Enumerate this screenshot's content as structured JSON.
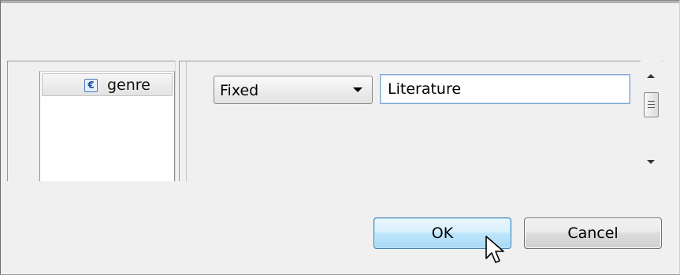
{
  "tree": {
    "items": [
      {
        "icon": "enum-icon",
        "icon_glyph": "€",
        "label": "genre"
      }
    ]
  },
  "editor": {
    "mode_selected": "Fixed",
    "value": "Literature"
  },
  "buttons": {
    "ok_label": "OK",
    "cancel_label": "Cancel"
  },
  "colors": {
    "dialog_bg": "#f0f0f0",
    "ok_border": "#3c7fb1",
    "field_focus": "#7fa6d6"
  }
}
